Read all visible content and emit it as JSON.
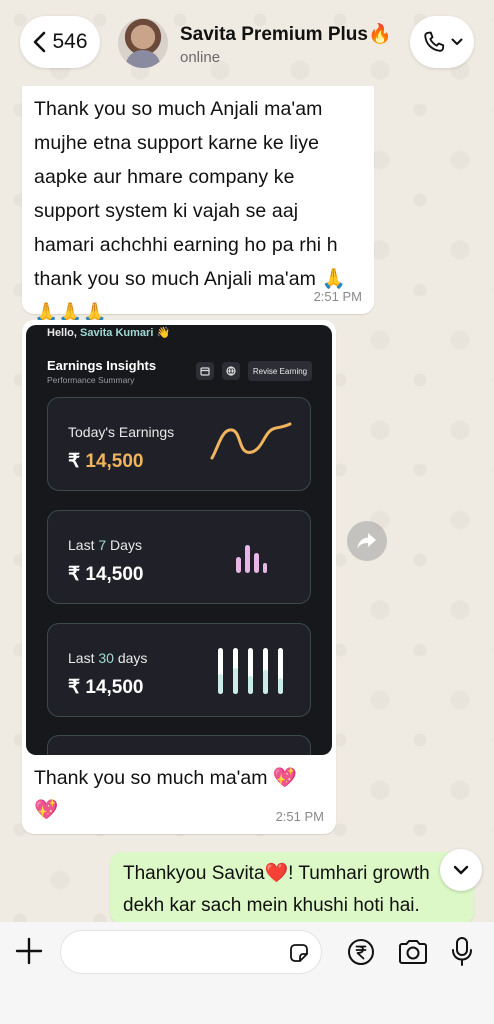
{
  "header": {
    "back_count": "546",
    "contact_name": "Savita Premium Plus🔥",
    "contact_status": "online"
  },
  "messages": [
    {
      "direction": "incoming",
      "lines": [
        "Thank you so much Anjali ma'am",
        "mujhe etna support karne ke liye",
        "aapke aur hmare company ke",
        "support system ki vajah se aaj",
        "hamari achchhi earning ho pa rhi h",
        "thank you so much Anjali ma'am 🙏",
        "🙏🙏🙏"
      ],
      "time": "2:51 PM"
    },
    {
      "direction": "incoming",
      "image": {
        "hello": "Hello,",
        "hello_name": "Savita Kumari",
        "hello_emoji": "👋",
        "title": "Earnings Insights",
        "subtitle": "Performance Summary",
        "revise_button": "Revise Earning",
        "cards": [
          {
            "label_pre": "Today's Earnings",
            "label_hl": "",
            "label_post": "",
            "currency": "₹",
            "amount": "14,500"
          },
          {
            "label_pre": "Last ",
            "label_hl": "7",
            "label_post": " Days",
            "currency": "₹",
            "amount": "14,500"
          },
          {
            "label_pre": "Last ",
            "label_hl": "30",
            "label_post": " days",
            "currency": "₹",
            "amount": "14,500"
          }
        ]
      },
      "caption_lines": [
        "Thank you so much ma'am 💖",
        "💖"
      ],
      "time": "2:51 PM"
    },
    {
      "direction": "outgoing",
      "lines": [
        "Thankyou Savita❤️! Tumhari growth",
        "dekh kar sach mein khushi hoti hai."
      ]
    }
  ],
  "input": {
    "placeholder": ""
  },
  "icons": {
    "back": "chevron-left-icon",
    "call": "phone-icon",
    "forward": "forward-arrow-icon",
    "scroll": "chevron-down-icon",
    "attach": "plus-icon",
    "sticker": "sticker-icon",
    "payment": "rupee-icon",
    "camera": "camera-icon",
    "mic": "mic-icon"
  },
  "colors": {
    "outgoing_bubble": "#dcf8c6",
    "incoming_bubble": "#ffffff",
    "wallpaper": "#efeae2",
    "accent_orange": "#f0b45e",
    "accent_teal": "#9fd9d3",
    "bar_pink": "#e6b6e6",
    "bar_mint": "#c9ece7"
  }
}
